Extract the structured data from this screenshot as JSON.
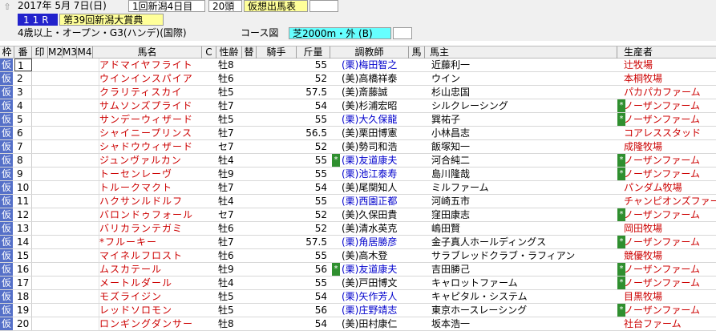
{
  "header": {
    "date": "2017年 5月 7日(日)",
    "meeting": "1回新潟4日目",
    "runners": "20頭",
    "sheet_title": "仮想出馬表",
    "race_no": "11R",
    "race_name": "第39回新潟大賞典",
    "conditions": "4歳以上・オープン・G3(ハンデ)(国際)",
    "course_label": "コース図",
    "course": "芝2000m・外 (B)"
  },
  "columns": [
    "枠",
    "番",
    "印",
    "M2",
    "M3",
    "M4",
    "馬名",
    "C",
    "性齢",
    "替",
    "騎手",
    "斤量",
    "調教師",
    "馬",
    "馬主",
    "生産者"
  ],
  "rows": [
    {
      "waku": "仮",
      "no": "1",
      "name": "アドマイヤフライト",
      "sex": "牡8",
      "kin": "55",
      "mark": "",
      "trainer": "(栗)梅田智之",
      "kurihi": true,
      "owner": "近藤利一",
      "bmark": "",
      "breeder": "辻牧場"
    },
    {
      "waku": "仮",
      "no": "2",
      "name": "ウインインスパイア",
      "sex": "牡6",
      "kin": "52",
      "mark": "",
      "trainer": "(美)高橋祥泰",
      "kurihi": false,
      "owner": "ウイン",
      "bmark": "",
      "breeder": "本桐牧場"
    },
    {
      "waku": "仮",
      "no": "3",
      "name": "クラリティスカイ",
      "sex": "牡5",
      "kin": "57.5",
      "mark": "",
      "trainer": "(美)斎藤誠",
      "kurihi": false,
      "owner": "杉山忠国",
      "bmark": "",
      "breeder": "パカパカファーム"
    },
    {
      "waku": "仮",
      "no": "4",
      "name": "サムソンズプライド",
      "sex": "牡7",
      "kin": "54",
      "mark": "",
      "trainer": "(美)杉浦宏昭",
      "kurihi": false,
      "owner": "シルクレーシング",
      "bmark": "*",
      "breeder": "ノーザンファーム"
    },
    {
      "waku": "仮",
      "no": "5",
      "name": "サンデーウィザード",
      "sex": "牡5",
      "kin": "55",
      "mark": "",
      "trainer": "(栗)大久保龍",
      "kurihi": true,
      "owner": "巽祐子",
      "bmark": "*",
      "breeder": "ノーザンファーム"
    },
    {
      "waku": "仮",
      "no": "6",
      "name": "シャイニープリンス",
      "sex": "牡7",
      "kin": "56.5",
      "mark": "",
      "trainer": "(美)栗田博憲",
      "kurihi": false,
      "owner": "小林昌志",
      "bmark": "",
      "breeder": "コアレススタッド"
    },
    {
      "waku": "仮",
      "no": "7",
      "name": "シャドウウィザード",
      "sex": "セ7",
      "kin": "52",
      "mark": "",
      "trainer": "(美)勢司和浩",
      "kurihi": false,
      "owner": "飯塚知一",
      "bmark": "",
      "breeder": "成隆牧場"
    },
    {
      "waku": "仮",
      "no": "8",
      "name": "ジュンヴァルカン",
      "sex": "牡4",
      "kin": "55",
      "mark": "*",
      "trainer": "(栗)友道康夫",
      "kurihi": true,
      "owner": "河合純二",
      "bmark": "*",
      "breeder": "ノーザンファーム"
    },
    {
      "waku": "仮",
      "no": "9",
      "name": "トーセンレーヴ",
      "sex": "牡9",
      "kin": "55",
      "mark": "",
      "trainer": "(栗)池江泰寿",
      "kurihi": true,
      "owner": "島川隆哉",
      "bmark": "*",
      "breeder": "ノーザンファーム"
    },
    {
      "waku": "仮",
      "no": "10",
      "name": "トルークマクト",
      "sex": "牡7",
      "kin": "54",
      "mark": "",
      "trainer": "(美)尾関知人",
      "kurihi": false,
      "owner": "ミルファーム",
      "bmark": "",
      "breeder": "パンダム牧場"
    },
    {
      "waku": "仮",
      "no": "11",
      "name": "ハクサンルドルフ",
      "sex": "牡4",
      "kin": "55",
      "mark": "",
      "trainer": "(栗)西園正都",
      "kurihi": true,
      "owner": "河崎五市",
      "bmark": "",
      "breeder": "チャンピオンズファーム"
    },
    {
      "waku": "仮",
      "no": "12",
      "name": "バロンドゥフォール",
      "sex": "セ7",
      "kin": "52",
      "mark": "",
      "trainer": "(美)久保田貴",
      "kurihi": false,
      "owner": "窪田康志",
      "bmark": "*",
      "breeder": "ノーザンファーム"
    },
    {
      "waku": "仮",
      "no": "13",
      "name": "バリカランテガミ",
      "sex": "牡6",
      "kin": "52",
      "mark": "",
      "trainer": "(美)清水英克",
      "kurihi": false,
      "owner": "嶋田賢",
      "bmark": "",
      "breeder": "岡田牧場"
    },
    {
      "waku": "仮",
      "no": "14",
      "name": "*フルーキー",
      "sex": "牡7",
      "kin": "57.5",
      "mark": "",
      "trainer": "(栗)角居勝彦",
      "kurihi": true,
      "owner": "金子真人ホールディングス",
      "bmark": "*",
      "breeder": "ノーザンファーム"
    },
    {
      "waku": "仮",
      "no": "15",
      "name": "マイネルフロスト",
      "sex": "牡6",
      "kin": "55",
      "mark": "",
      "trainer": "(美)高木登",
      "kurihi": false,
      "owner": "サラブレッドクラブ・ラフィアン",
      "bmark": "",
      "breeder": "競優牧場"
    },
    {
      "waku": "仮",
      "no": "16",
      "name": "ムスカテール",
      "sex": "牡9",
      "kin": "56",
      "mark": "*",
      "trainer": "(栗)友道康夫",
      "kurihi": true,
      "owner": "吉田勝己",
      "bmark": "*",
      "breeder": "ノーザンファーム"
    },
    {
      "waku": "仮",
      "no": "17",
      "name": "メートルダール",
      "sex": "牡4",
      "kin": "55",
      "mark": "",
      "trainer": "(美)戸田博文",
      "kurihi": false,
      "owner": "キャロットファーム",
      "bmark": "*",
      "breeder": "ノーザンファーム"
    },
    {
      "waku": "仮",
      "no": "18",
      "name": "モズライジン",
      "sex": "牡5",
      "kin": "54",
      "mark": "",
      "trainer": "(栗)矢作芳人",
      "kurihi": true,
      "owner": "キャピタル・システム",
      "bmark": "",
      "breeder": "目黒牧場"
    },
    {
      "waku": "仮",
      "no": "19",
      "name": "レッドソロモン",
      "sex": "牡5",
      "kin": "56",
      "mark": "",
      "trainer": "(栗)庄野靖志",
      "kurihi": true,
      "owner": "東京ホースレーシング",
      "bmark": "*",
      "breeder": "ノーザンファーム"
    },
    {
      "waku": "仮",
      "no": "20",
      "name": "ロンギングダンサー",
      "sex": "牡8",
      "kin": "54",
      "mark": "",
      "trainer": "(美)田村康仁",
      "kurihi": false,
      "owner": "坂本浩一",
      "bmark": "",
      "breeder": "社台ファーム"
    }
  ]
}
